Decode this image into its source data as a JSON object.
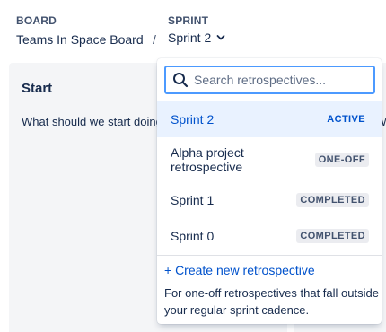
{
  "header": {
    "board_label": "BOARD",
    "board_name": "Teams In Space Board",
    "separator": "/",
    "sprint_label": "SPRINT",
    "sprint_value": "Sprint 2"
  },
  "column": {
    "title": "Start",
    "description": "What should we start doing?",
    "next_description_fragment": "W"
  },
  "dropdown": {
    "search_placeholder": "Search retrospectives...",
    "items": [
      {
        "label": "Sprint 2",
        "badge": "ACTIVE",
        "selected": true
      },
      {
        "label": "Alpha project retrospective",
        "badge": "ONE-OFF",
        "selected": false
      },
      {
        "label": "Sprint 1",
        "badge": "COMPLETED",
        "selected": false
      },
      {
        "label": "Sprint 0",
        "badge": "COMPLETED",
        "selected": false
      }
    ],
    "create_label": "+ Create new retrospective",
    "create_help": "For one-off retrospectives that fall outside your regular sprint cadence."
  },
  "colors": {
    "accent": "#0052cc",
    "selected_bg": "#e9f2ff",
    "focus_border": "#4c9aff",
    "badge_bg": "#ebecf0"
  },
  "icons": {
    "search": "search-icon",
    "chevron": "chevron-down-icon"
  }
}
